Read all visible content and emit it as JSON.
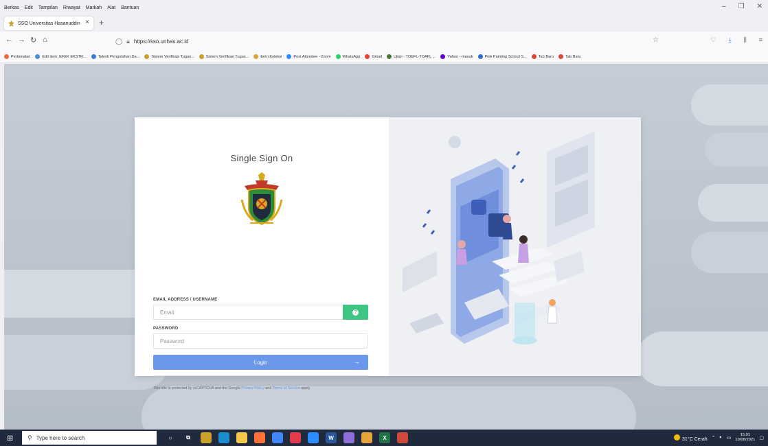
{
  "menubar": {
    "items": [
      "Berkas",
      "Edit",
      "Tampilan",
      "Riwayat",
      "Markah",
      "Alat",
      "Bantuan"
    ]
  },
  "tab": {
    "title": "SSO Universitas Hasanuddin",
    "close": "×",
    "new_tab": "+"
  },
  "navbar": {
    "url": "https://sso.unhas.ac.id"
  },
  "bookmarks": [
    {
      "label": "Perkenalan",
      "color": "#e8693a"
    },
    {
      "label": "Edit item: EFEK EKSTR...",
      "color": "#4a8bd6"
    },
    {
      "label": "Teknik Pengolahan Da...",
      "color": "#3b7bd4"
    },
    {
      "label": "Sistem Verifikasi Tugas...",
      "color": "#c8a02a"
    },
    {
      "label": "Sistem Verifikasi Tugas...",
      "color": "#c8a02a"
    },
    {
      "label": "Entri Koleksi",
      "color": "#d9a53a"
    },
    {
      "label": "Post Attendee - Zoom",
      "color": "#2d8cff"
    },
    {
      "label": "WhatsApp",
      "color": "#25d366"
    },
    {
      "label": "Gmail",
      "color": "#ea4335"
    },
    {
      "label": "Ujian - TOEFL-TOAFL ...",
      "color": "#4a7a3a"
    },
    {
      "label": "Yahoo - masuk",
      "color": "#6001d2"
    },
    {
      "label": "Pink Painting School S...",
      "color": "#2a6fd6"
    },
    {
      "label": "Tab Baru",
      "color": "#e0453b"
    },
    {
      "label": "Tab Baru",
      "color": "#e0453b"
    }
  ],
  "login": {
    "title": "Single Sign On",
    "email_label": "EMAIL ADDRESS / USERNAME",
    "email_placeholder": "Email",
    "password_label": "PASSWORD",
    "password_placeholder": "Password",
    "login_button": "Login",
    "recaptcha_prefix": "This site is protected by reCAPTCHA and the Google ",
    "privacy_link": "Privacy Policy",
    "and": " and ",
    "terms_link": "Terms of Service",
    "recaptcha_suffix": " apply."
  },
  "taskbar": {
    "search_placeholder": "Type here to search",
    "weather": "31°C Cerah",
    "time": "15.01",
    "date": "19/08/2021"
  },
  "colors": {
    "accent_blue": "#6a97ea",
    "help_green": "#3ec483"
  }
}
